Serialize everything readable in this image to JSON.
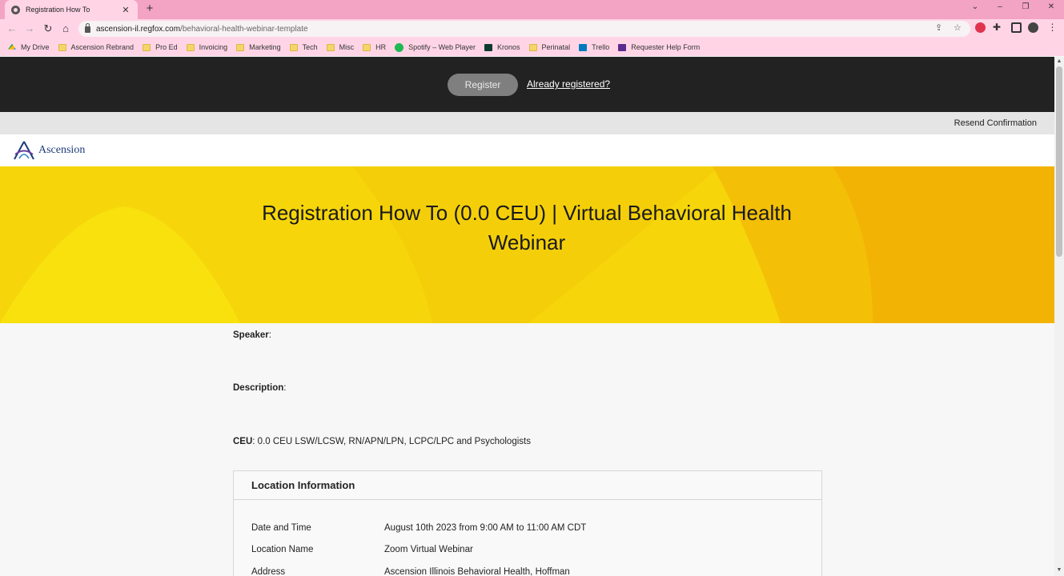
{
  "browser": {
    "tab_title": "Registration How To",
    "url_host": "ascension-il.regfox.com",
    "url_path": "/behavioral-health-webinar-template",
    "bookmarks": [
      {
        "label": "My Drive",
        "icon": "drive-icon"
      },
      {
        "label": "Ascension Rebrand",
        "icon": "folder-icon"
      },
      {
        "label": "Pro Ed",
        "icon": "folder-icon"
      },
      {
        "label": "Invoicing",
        "icon": "folder-icon"
      },
      {
        "label": "Marketing",
        "icon": "folder-icon"
      },
      {
        "label": "Tech",
        "icon": "folder-icon"
      },
      {
        "label": "Misc",
        "icon": "folder-icon"
      },
      {
        "label": "HR",
        "icon": "folder-icon"
      },
      {
        "label": "Spotify – Web Player",
        "icon": "spotify-icon"
      },
      {
        "label": "Kronos",
        "icon": "kronos-icon"
      },
      {
        "label": "Perinatal",
        "icon": "folder-icon"
      },
      {
        "label": "Trello",
        "icon": "trello-icon"
      },
      {
        "label": "Requester Help Form",
        "icon": "form-icon"
      }
    ]
  },
  "header": {
    "register_label": "Register",
    "already_registered_label": "Already registered?",
    "resend_label": "Resend Confirmation",
    "logo_text": "Ascension"
  },
  "hero": {
    "title": "Registration How To (0.0 CEU) | Virtual Behavioral Health Webinar"
  },
  "details": {
    "speaker_label": "Speaker",
    "speaker_value": "",
    "description_label": "Description",
    "description_value": "",
    "ceu_label": "CEU",
    "ceu_value": "0.0 CEU LSW/LCSW, RN/APN/LPN, LCPC/LPC and Psychologists"
  },
  "location": {
    "heading": "Location Information",
    "rows": [
      {
        "label": "Date and Time",
        "value": "August 10th 2023 from 9:00 AM to 11:00 AM CDT"
      },
      {
        "label": "Location Name",
        "value": "Zoom Virtual Webinar"
      },
      {
        "label": "Address",
        "value": "Ascension Illinois Behavioral Health, Hoffman"
      }
    ]
  },
  "colors": {
    "hero_yellow": "#f6d60a",
    "hero_orange": "#f3b304",
    "dark_bar": "#222222",
    "brand_blue": "#1e3a7a",
    "chrome_pink": "#f3a3c3"
  }
}
